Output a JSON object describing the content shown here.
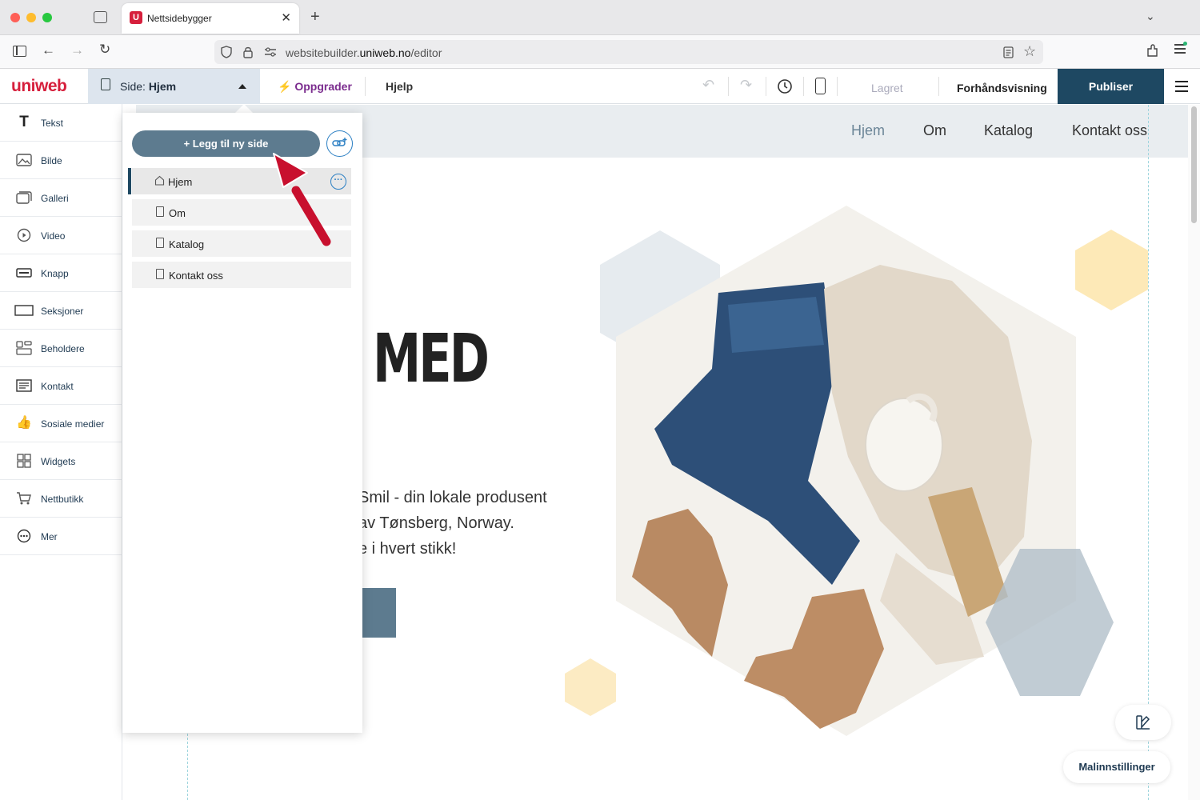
{
  "browser": {
    "tab_title": "Nettsidebygger",
    "url_prefix": "websitebuilder.",
    "url_domain": "uniweb.no",
    "url_path": "/editor",
    "favicon_letter": "U"
  },
  "app": {
    "logo": "uniweb",
    "page_selector_prefix": "Side:",
    "page_selector_value": "Hjem",
    "upgrade_label": "Oppgrader",
    "help_label": "Hjelp",
    "saved_label": "Lagret",
    "preview_label": "Forhåndsvisning",
    "publish_label": "Publiser",
    "brand_color": "#d61f3c",
    "accent_color": "#1e4862"
  },
  "sidebar": {
    "items": [
      {
        "label": "Tekst",
        "icon": "text-icon"
      },
      {
        "label": "Bilde",
        "icon": "image-icon"
      },
      {
        "label": "Galleri",
        "icon": "gallery-icon"
      },
      {
        "label": "Video",
        "icon": "video-icon"
      },
      {
        "label": "Knapp",
        "icon": "button-icon"
      },
      {
        "label": "Seksjoner",
        "icon": "sections-icon"
      },
      {
        "label": "Beholdere",
        "icon": "containers-icon"
      },
      {
        "label": "Kontakt",
        "icon": "contact-form-icon"
      },
      {
        "label": "Sosiale medier",
        "icon": "thumbs-up-icon"
      },
      {
        "label": "Widgets",
        "icon": "widgets-icon"
      },
      {
        "label": "Nettbutikk",
        "icon": "cart-icon"
      },
      {
        "label": "Mer",
        "icon": "more-icon"
      }
    ]
  },
  "pages_panel": {
    "add_label": "+ Legg til ny side",
    "pages": [
      {
        "label": "Hjem",
        "icon": "home-icon",
        "active": true
      },
      {
        "label": "Om",
        "icon": "page-icon",
        "active": false
      },
      {
        "label": "Katalog",
        "icon": "page-icon",
        "active": false
      },
      {
        "label": "Kontakt oss",
        "icon": "page-icon",
        "active": false
      }
    ]
  },
  "site": {
    "nav": [
      "Hjem",
      "Om",
      "Katalog",
      "Kontakt oss"
    ],
    "hero_title": "MED",
    "hero_lines": [
      "Smil - din lokale produsent",
      "av Tønsberg, Norway.",
      "e i hvert stikk!"
    ]
  },
  "floating": {
    "template_settings_label": "Malinnstillinger"
  }
}
